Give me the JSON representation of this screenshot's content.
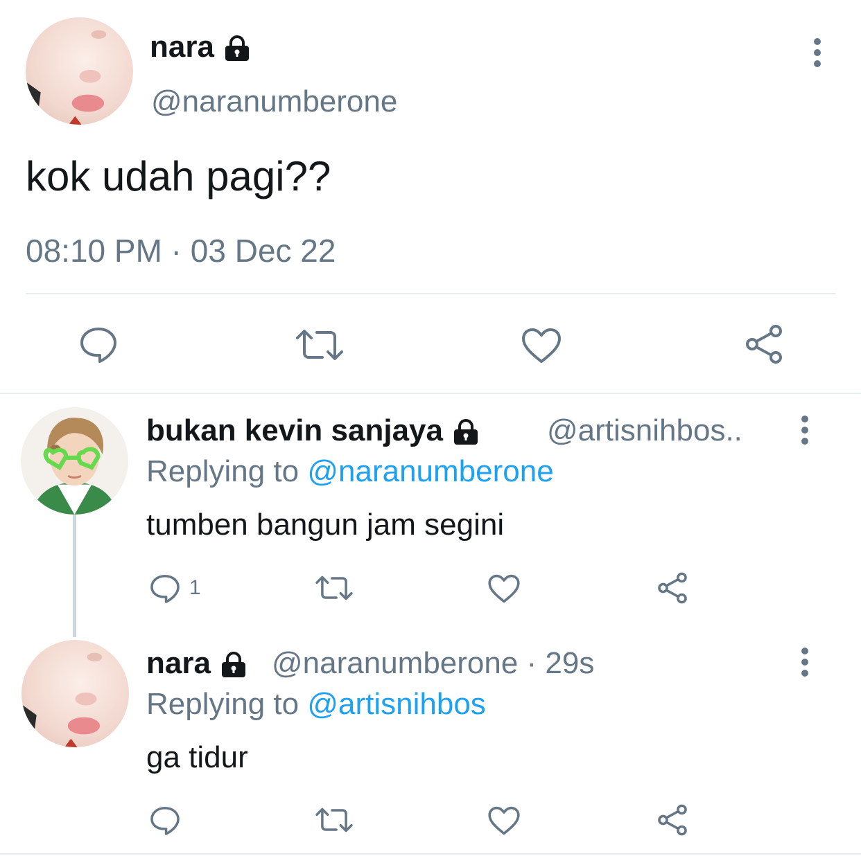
{
  "main_tweet": {
    "display_name": "nara",
    "handle": "@naranumberone",
    "text": "kok udah pagi??",
    "timestamp": "08:10 PM · 03 Dec 22",
    "icons": [
      "reply-icon",
      "retweet-icon",
      "like-icon",
      "share-icon"
    ]
  },
  "replies": [
    {
      "display_name": "bukan kevin sanjaya",
      "handle": "@artisnihbos..",
      "replying_prefix": "Replying to ",
      "replying_to": "@naranumberone",
      "text": "tumben bangun jam segini",
      "reply_count": "1"
    },
    {
      "display_name": "nara",
      "handle": "@naranumberone · 29s",
      "replying_prefix": "Replying to ",
      "replying_to": "@artisnihbos",
      "text": "ga tidur"
    }
  ],
  "colors": {
    "text": "#14171a",
    "secondary": "#657786",
    "link": "#1da1f2",
    "divider": "#e6ecf0",
    "thread_line": "#ccd6dd"
  }
}
